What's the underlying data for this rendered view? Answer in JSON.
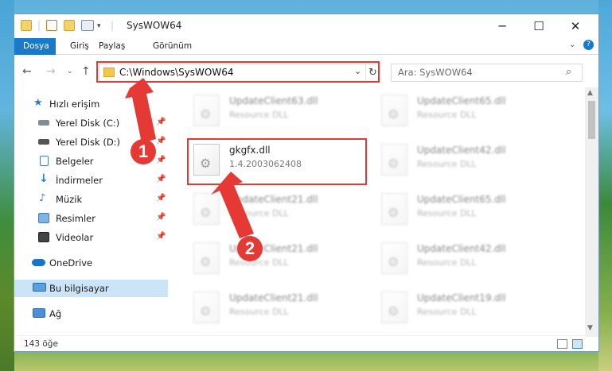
{
  "window": {
    "title": "SysWOW64"
  },
  "ribbon": {
    "tabs": [
      "Dosya",
      "Giriş",
      "Paylaş",
      "Görünüm"
    ]
  },
  "address": {
    "path": "C:\\Windows\\SysWOW64"
  },
  "search": {
    "placeholder": "Ara: SysWOW64"
  },
  "sidebar": {
    "items": [
      {
        "label": "Hızlı erişim",
        "icon": "star-icon",
        "pinned": false,
        "selected": false
      },
      {
        "label": "Yerel Disk (C:)",
        "icon": "disk-icon",
        "pinned": true,
        "selected": false
      },
      {
        "label": "Yerel Disk (D:)",
        "icon": "disk-icon",
        "pinned": true,
        "selected": false
      },
      {
        "label": "Belgeler",
        "icon": "documents-icon",
        "pinned": true,
        "selected": false
      },
      {
        "label": "İndirmeler",
        "icon": "download-icon",
        "pinned": true,
        "selected": false
      },
      {
        "label": "Müzik",
        "icon": "music-icon",
        "pinned": true,
        "selected": false
      },
      {
        "label": "Resimler",
        "icon": "pictures-icon",
        "pinned": true,
        "selected": false
      },
      {
        "label": "Videolar",
        "icon": "videos-icon",
        "pinned": true,
        "selected": false
      },
      {
        "label": "OneDrive",
        "icon": "cloud-icon",
        "pinned": false,
        "selected": false
      },
      {
        "label": "Bu bilgisayar",
        "icon": "computer-icon",
        "pinned": false,
        "selected": true
      },
      {
        "label": "Ağ",
        "icon": "network-icon",
        "pinned": false,
        "selected": false
      }
    ]
  },
  "files": [
    {
      "name": "UpdateClient63.dll",
      "desc": "Resource DLL"
    },
    {
      "name": "UpdateClient65.dll",
      "desc": "Resource DLL"
    },
    {
      "name": "gkgfx.dll",
      "desc": "1.4.2003062408"
    },
    {
      "name": "UpdateClient42.dll",
      "desc": "Resource DLL"
    },
    {
      "name": "UpdateClient21.dll",
      "desc": "Resource DLL"
    },
    {
      "name": "UpdateClient65.dll",
      "desc": "Resource DLL"
    },
    {
      "name": "UpdateClient21.dll",
      "desc": "Resource DLL"
    },
    {
      "name": "UpdateClient42.dll",
      "desc": "Resource DLL"
    },
    {
      "name": "UpdateClient21.dll",
      "desc": "Resource DLL"
    },
    {
      "name": "UpdateClient19.dll",
      "desc": "Resource DLL"
    }
  ],
  "status": {
    "count": "143 öğe"
  },
  "annotations": {
    "marker1": "1",
    "marker2": "2",
    "color": "#e53935"
  }
}
